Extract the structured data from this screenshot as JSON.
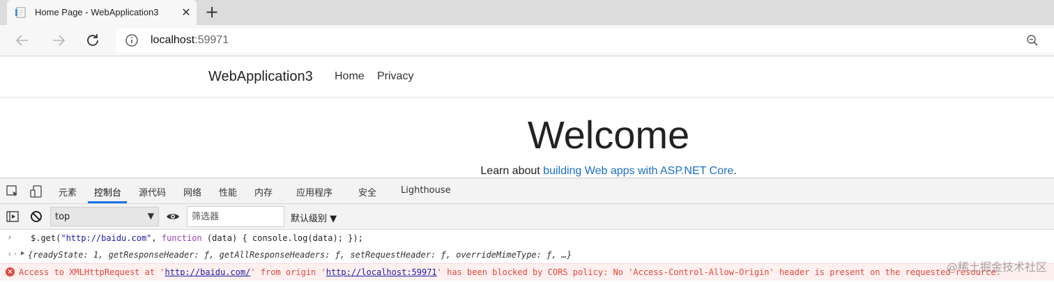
{
  "browser": {
    "tab_title": "Home Page - WebApplication3",
    "close_tab_glyph": "✕",
    "new_tab_glyph": "+",
    "url_host": "localhost",
    "url_port": ":59971"
  },
  "site": {
    "brand": "WebApplication3",
    "nav": [
      "Home",
      "Privacy"
    ],
    "welcome": "Welcome",
    "learn_prefix": "Learn about ",
    "learn_link": "building Web apps with ASP.NET Core",
    "learn_suffix": "."
  },
  "devtools": {
    "tabs": [
      "元素",
      "控制台",
      "源代码",
      "网络",
      "性能",
      "内存",
      "应用程序",
      "安全",
      "Lighthouse"
    ],
    "active_tab": "控制台",
    "context": "top",
    "filter_placeholder": "筛选器",
    "levels": "默认级别 ▼"
  },
  "console": {
    "command_prefix": "$.get(",
    "command_url": "\"http://baidu.com\"",
    "command_sep": ", ",
    "command_kw": "function",
    "command_rest": " (data) { console.log(data); });",
    "result": "{readyState: 1, getResponseHeader: ƒ, getAllResponseHeaders: ƒ, setRequestHeader: ƒ, overrideMimeType: ƒ, …}",
    "error_1": "Access to XMLHttpRequest at '",
    "error_url1": "http://baidu.com/",
    "error_2": "' from origin '",
    "error_url2": "http://localhost:59971",
    "error_3": "' has been blocked by CORS policy: No 'Access-Control-Allow-Origin' header is present on the requested resource."
  },
  "watermark": "@稀土掘金技术社区",
  "colors": {
    "link": "#1b6ec2",
    "error": "#e0463b",
    "active_tab": "#1a73e8"
  }
}
